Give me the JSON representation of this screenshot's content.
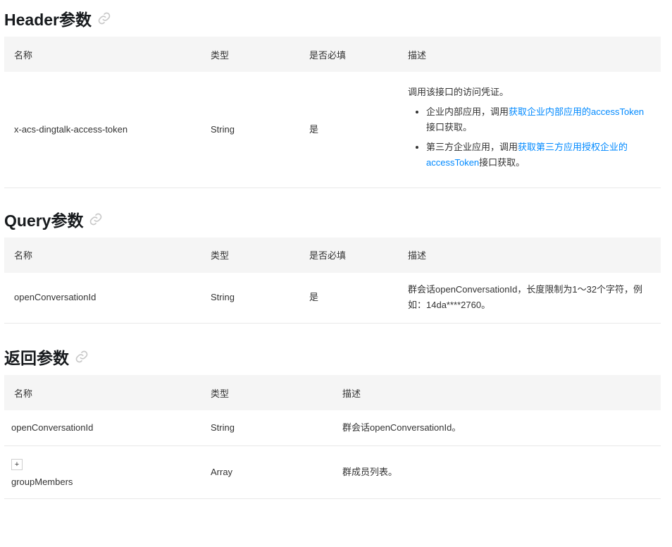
{
  "header_section": {
    "title": "Header参数",
    "columns": [
      "名称",
      "类型",
      "是否必填",
      "描述"
    ],
    "row": {
      "name": "x-acs-dingtalk-access-token",
      "type": "String",
      "required": "是",
      "desc_intro": "调用该接口的访问凭证。",
      "bullets": [
        {
          "prefix": "企业内部应用，调用",
          "link": "获取企业内部应用的accessToken",
          "suffix": "接口获取。"
        },
        {
          "prefix": "第三方企业应用，调用",
          "link": "获取第三方应用授权企业的accessToken",
          "suffix": "接口获取。"
        }
      ]
    }
  },
  "query_section": {
    "title": "Query参数",
    "columns": [
      "名称",
      "类型",
      "是否必填",
      "描述"
    ],
    "row": {
      "name": "openConversationId",
      "type": "String",
      "required": "是",
      "desc": "群会话openConversationId，长度限制为1～32个字符，例如：14da****2760。"
    }
  },
  "return_section": {
    "title": "返回参数",
    "columns": [
      "名称",
      "类型",
      "描述"
    ],
    "rows": [
      {
        "name": "openConversationId",
        "type": "String",
        "desc": "群会话openConversationId。"
      },
      {
        "expand": "+",
        "name": "groupMembers",
        "type": "Array",
        "desc": "群成员列表。"
      }
    ]
  },
  "colors": {
    "link": "#0089ff",
    "header_bg": "#f5f5f5",
    "border": "#e8e8e8"
  }
}
